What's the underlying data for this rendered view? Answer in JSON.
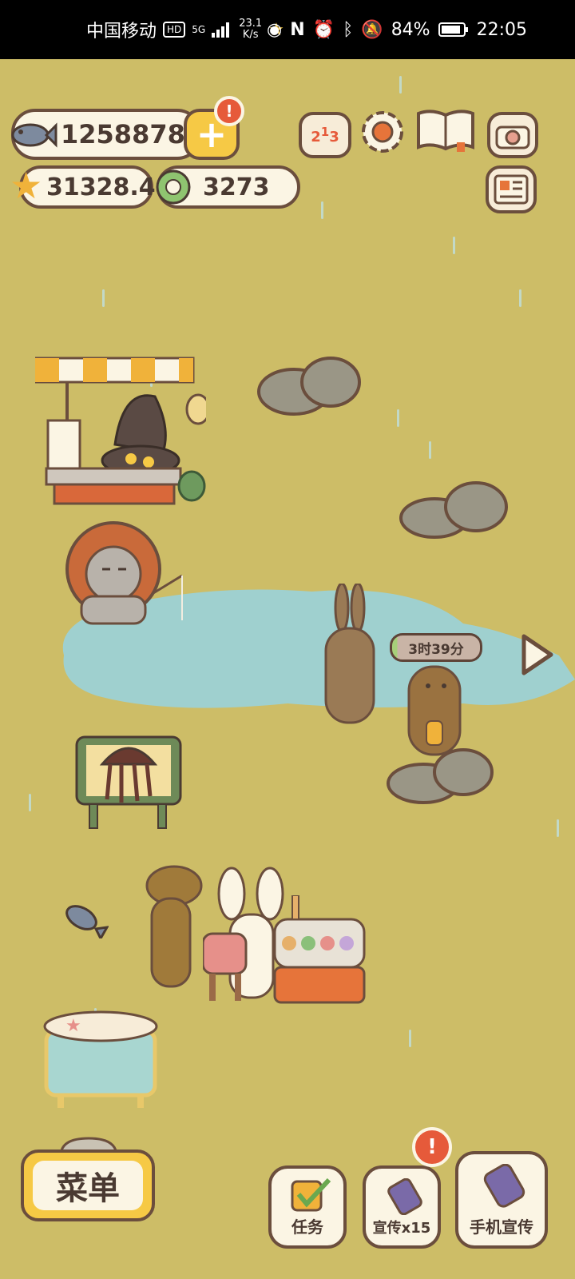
{
  "status_bar": {
    "carrier": "中国移动",
    "hd": "HD",
    "signal_type": "5G",
    "net_speed_value": "23.1",
    "net_speed_unit": "K/s",
    "battery": "84%",
    "time": "22:05"
  },
  "hud": {
    "fish_count": "1258878",
    "star_count": "31328.4",
    "gem_count": "3273",
    "plus_badge": "!"
  },
  "scene": {
    "timer_label": "3时39分"
  },
  "bottom": {
    "menu_label": "菜单",
    "task_label": "任务",
    "promo_label": "宣传x15",
    "promo_badge": "!",
    "phone_promo_label": "手机宣传"
  },
  "colors": {
    "background": "#cdbd67",
    "pond": "#9fd0cf",
    "outline": "#6b4e3d",
    "accent_yellow": "#f6c945",
    "badge_red": "#e65a3a"
  }
}
